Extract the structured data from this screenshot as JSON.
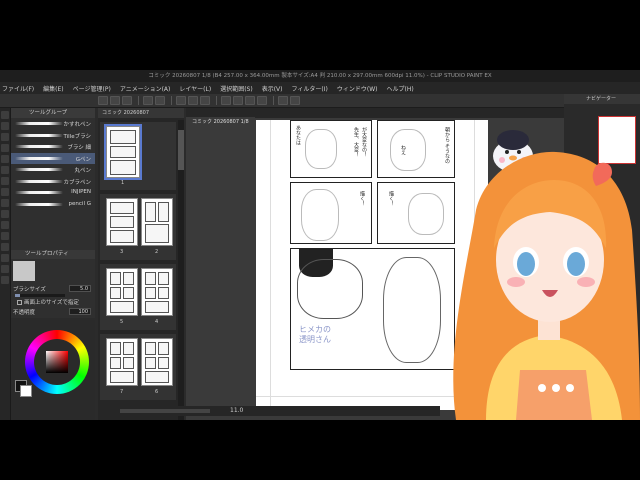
{
  "window": {
    "title": "コミック 20260807 1/8 (B4 257.00 x 364.00mm 製本サイズ:A4 判 210.00 x 297.00mm 600dpi 11.0%) - CLIP STUDIO PAINT EX"
  },
  "menu": [
    "ファイル(F)",
    "編集(E)",
    "ページ管理(P)",
    "アニメーション(A)",
    "レイヤー(L)",
    "選択範囲(S)",
    "表示(V)",
    "フィルター(I)",
    "ウィンドウ(W)",
    "ヘルプ(H)"
  ],
  "brush_panel": {
    "header": "ツールグループ",
    "brushes": [
      {
        "name": "かすれペン"
      },
      {
        "name": "Tilleブラシ"
      },
      {
        "name": "ブラシ 細"
      },
      {
        "name": "Gペン",
        "selected": true
      },
      {
        "name": "丸ペン"
      },
      {
        "name": "カブラペン"
      },
      {
        "name": "INJIPEN"
      },
      {
        "name": "pencil G"
      }
    ]
  },
  "tool_property": {
    "header": "ツールプロパティ",
    "brush_size_label": "ブラシサイズ",
    "brush_size_value": "5.0",
    "brush_size_fraction": 0.1,
    "checkbox_label": "画面上のサイズで指定",
    "opacity_label": "不透明度",
    "opacity_value": "100",
    "opacity_fraction": 1.0
  },
  "color": {
    "main": "#111111",
    "sub": "#ffffff"
  },
  "page_manager": {
    "tab_label": "コミック 20260807",
    "pages": [
      {
        "num": "1",
        "selected": true
      },
      {
        "num": "3"
      },
      {
        "num": "2"
      },
      {
        "num": "5"
      },
      {
        "num": "4"
      },
      {
        "num": "7"
      },
      {
        "num": "6"
      }
    ]
  },
  "canvas": {
    "tab_label": "コミック 20260807 1/8",
    "handwritten_text": "ヒメカの 透明さん",
    "dialogue": [
      "が大変なの！",
      "先生、大変！",
      "朝から そうなの",
      "描く！",
      "あなたは",
      "ねえ",
      "描く！"
    ]
  },
  "status": {
    "zoom": "11.0"
  },
  "navigator": {
    "tab_label": "ナビゲーター"
  }
}
